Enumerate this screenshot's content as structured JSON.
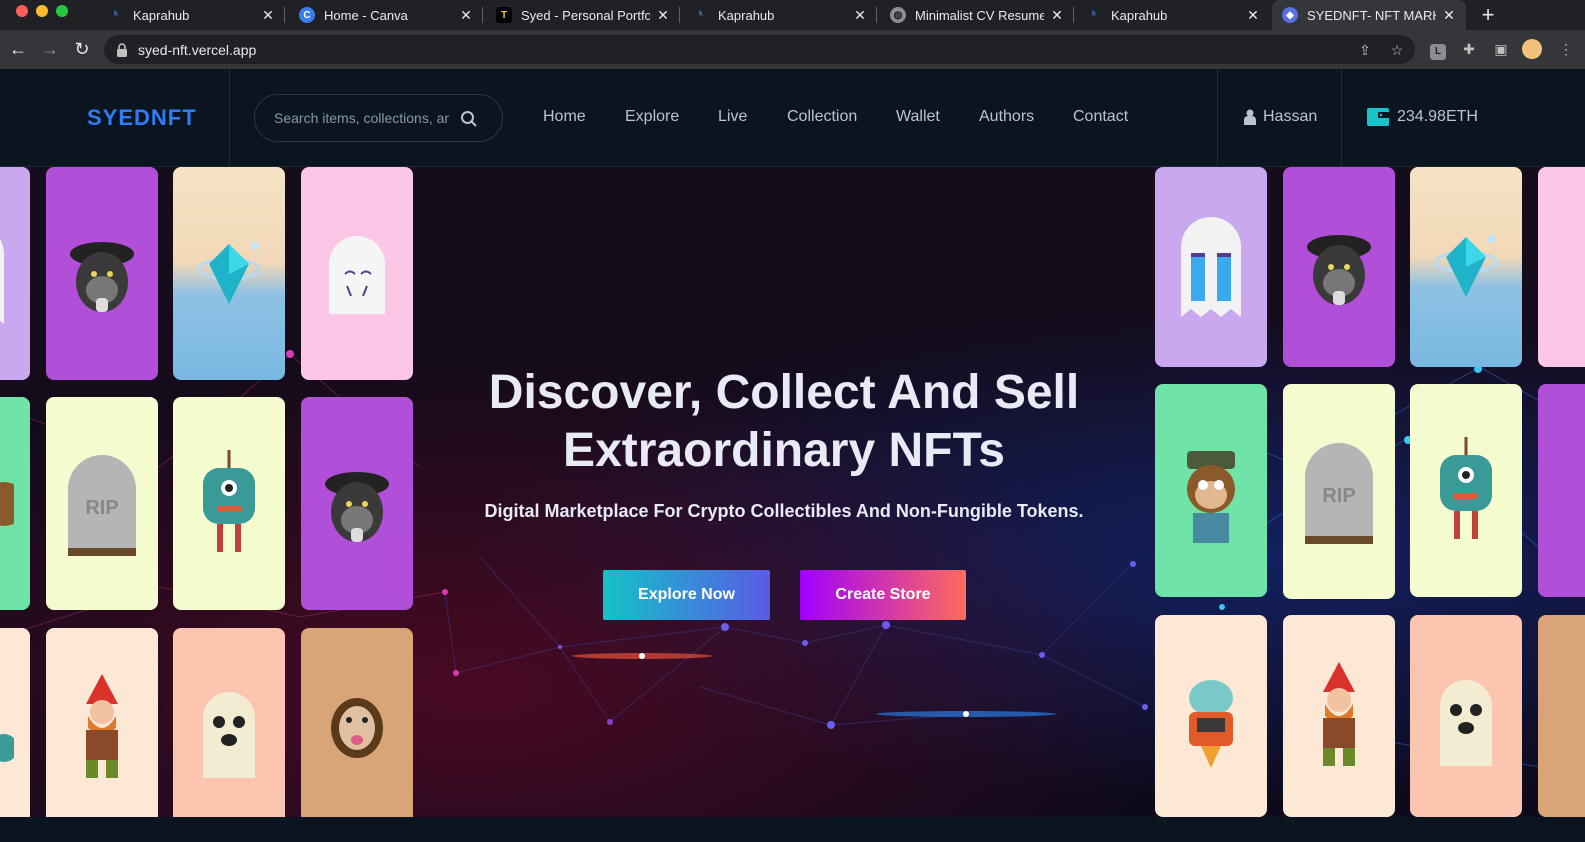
{
  "browser": {
    "tabs": [
      {
        "title": "Kaprahub",
        "icon": "kaprahub-icon"
      },
      {
        "title": "Home - Canva",
        "icon": "canva-icon"
      },
      {
        "title": "Syed - Personal Portfolio",
        "icon": "portfolio-icon"
      },
      {
        "title": "Kaprahub",
        "icon": "kaprahub-icon"
      },
      {
        "title": "Minimalist CV Resume",
        "icon": "globe-icon"
      },
      {
        "title": "Kaprahub",
        "icon": "kaprahub-icon"
      },
      {
        "title": "SYEDNFT- NFT MARKETPLACE",
        "icon": "ethereum-icon",
        "active": true
      }
    ],
    "url": "syed-nft.vercel.app"
  },
  "header": {
    "logo": "SYEDNFT",
    "search_placeholder": "Search items, collections, and accounts",
    "nav": [
      "Home",
      "Explore",
      "Live",
      "Collection",
      "Wallet",
      "Authors",
      "Contact"
    ],
    "user": "Hassan",
    "balance": "234.98ETH"
  },
  "hero": {
    "title_line1": "Discover, Collect And Sell",
    "title_line2": "Extraordinary NFTs",
    "subtitle": "Digital Marketplace For Crypto Collectibles And Non-Fungible Tokens.",
    "explore_button": "Explore Now",
    "create_button": "Create Store"
  },
  "colors": {
    "brand": "#2f7df6",
    "header_bg": "#0b1520",
    "explore_gradient": [
      "#12c2c8",
      "#5a5ae6"
    ],
    "create_gradient": [
      "#a100ff",
      "#ff6b5b"
    ]
  }
}
